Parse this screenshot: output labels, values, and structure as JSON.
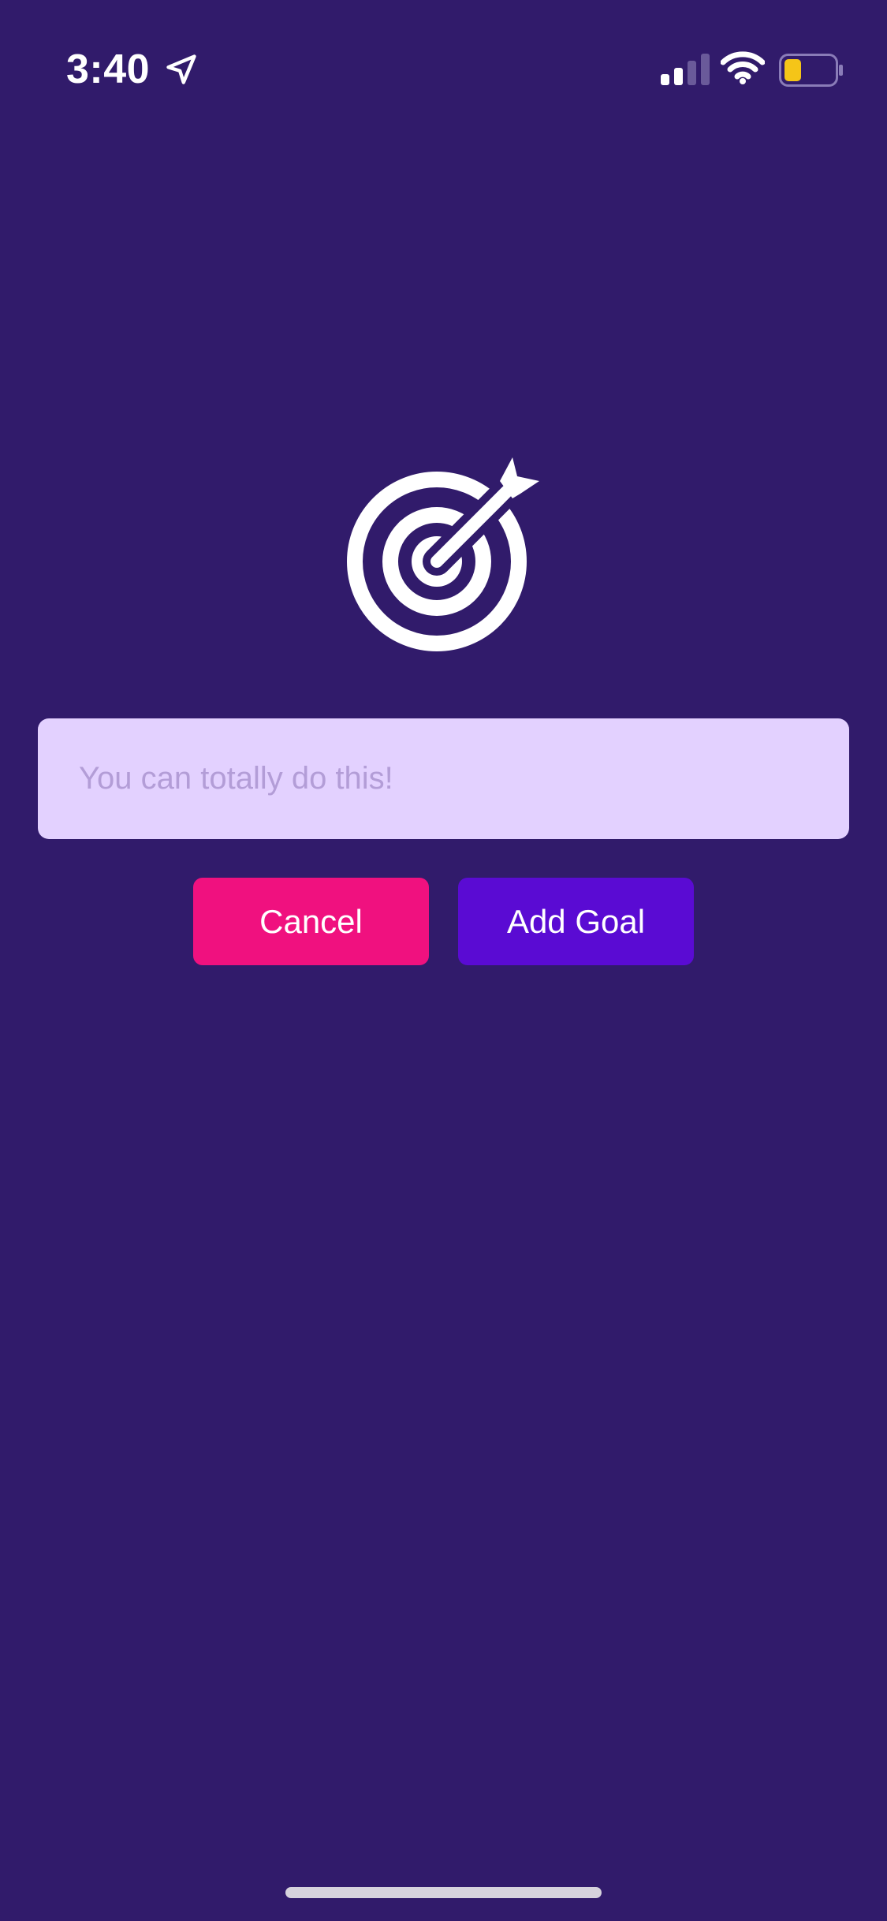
{
  "status_bar": {
    "time": "3:40",
    "location_icon": "location-arrow-icon",
    "signal_icon": "cellular-signal-icon",
    "signal_bars_active": 2,
    "signal_bars_total": 4,
    "wifi_icon": "wifi-icon",
    "battery_icon": "battery-icon",
    "battery_level": 0.35,
    "battery_color": "#f5c518"
  },
  "illustration": {
    "icon": "target-with-arrow-icon"
  },
  "goal_form": {
    "input_value": "",
    "input_placeholder": "You can totally do this!",
    "cancel_label": "Cancel",
    "add_goal_label": "Add Goal"
  },
  "colors": {
    "background": "#311b6b",
    "input_background": "#e3d1ff",
    "input_placeholder": "#b39dd7",
    "cancel_button": "#f0117f",
    "add_button": "#5a0bd3",
    "icon": "#ffffff"
  }
}
